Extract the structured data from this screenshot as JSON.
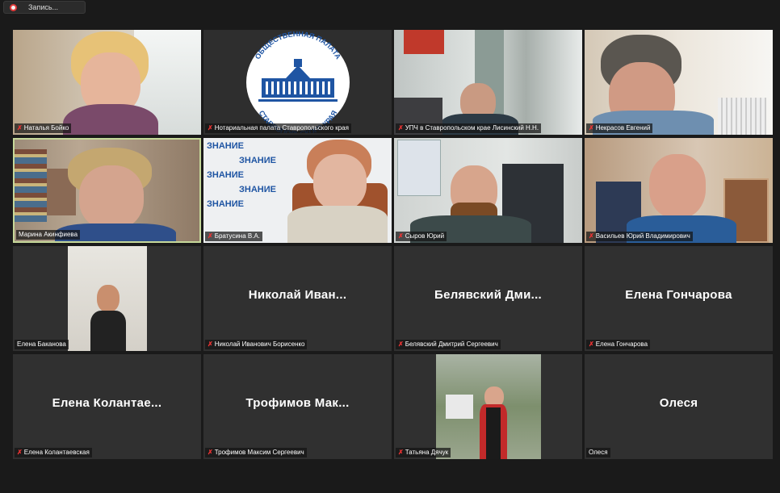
{
  "recording": {
    "label": "Запись..."
  },
  "tiles": [
    {
      "label": "Наталья Бойко",
      "muted": true
    },
    {
      "label": "Нотариальная палата Ставропольского края",
      "muted": true
    },
    {
      "label": "УПЧ в Ставропольском крае Лисинский Н.Н.",
      "muted": true
    },
    {
      "label": "Некрасов Евгений",
      "muted": true
    },
    {
      "label": "Марина Акинфиева",
      "muted": false
    },
    {
      "label": "Братусина В.А.",
      "muted": true
    },
    {
      "label": "Сыров Юрий",
      "muted": true
    },
    {
      "label": "Васильев Юрий Владимирович",
      "muted": true
    },
    {
      "label": "Елена Баканова",
      "muted": false
    },
    {
      "label": "Николай Иванович Борисенко",
      "display": "Николай  Иван...",
      "muted": true
    },
    {
      "label": "Белявский Дмитрий Сергеевич",
      "display": "Белявский  Дми...",
      "muted": true
    },
    {
      "label": "Елена Гончарова",
      "display": "Елена Гончарова",
      "muted": true
    },
    {
      "label": "Елена Колантаевская",
      "display": "Елена  Колантае...",
      "muted": true
    },
    {
      "label": "Трофимов Максим Сергеевич",
      "display": "Трофимов  Мак...",
      "muted": true
    },
    {
      "label": "Татьяна Дячук",
      "muted": true
    },
    {
      "label": "Олеся",
      "display": "Олеся",
      "muted": false
    }
  ],
  "logo": {
    "top_text": "ОБЩЕСТВЕННАЯ ПАЛАТА",
    "bottom_text": "СТАВРОПОЛЬСКОГО КРАЯ"
  },
  "banner": {
    "word": "ЗНАНИЕ"
  },
  "colors": {
    "active_border": "#c6d89a",
    "muted_icon": "#e33",
    "tile_bg": "#303030"
  }
}
